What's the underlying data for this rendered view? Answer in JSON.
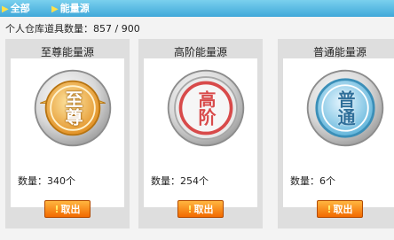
{
  "tabs": [
    {
      "label": "全部",
      "icon": "chevron-right-icon"
    },
    {
      "label": "能量源",
      "icon": "chevron-right-icon"
    }
  ],
  "inventory": {
    "label": "个人仓库道具数量：",
    "current": "857",
    "separator": "/",
    "max": "900"
  },
  "colors": {
    "tab_bar": "#40a8d9",
    "button": "#f26a00",
    "gold": "#e9a33a",
    "red": "#d84a4a",
    "blue": "#58b0d8"
  },
  "cards": [
    {
      "title": "至尊能量源",
      "emblem_text": "至尊",
      "emblem_icon": "gold-emblem-icon",
      "quantity_label": "数量：",
      "quantity": "340个",
      "button": "取出",
      "button_icon": "exclamation-icon"
    },
    {
      "title": "高阶能量源",
      "emblem_text": "高阶",
      "emblem_icon": "red-emblem-icon",
      "quantity_label": "数量：",
      "quantity": "254个",
      "button": "取出",
      "button_icon": "exclamation-icon"
    },
    {
      "title": "普通能量源",
      "emblem_text": "普通",
      "emblem_icon": "blue-emblem-icon",
      "quantity_label": "数量：",
      "quantity": "6个",
      "button": "取出",
      "button_icon": "exclamation-icon"
    }
  ]
}
